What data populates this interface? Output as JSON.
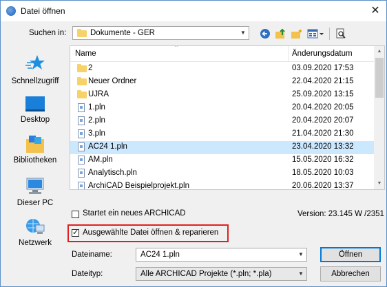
{
  "window": {
    "title": "Datei öffnen",
    "close_symbol": "✕"
  },
  "toolbar": {
    "look_in_label": "Suchen in:",
    "look_in_value": "Dokumente - GER"
  },
  "places": [
    {
      "label": "Schnellzugriff",
      "icon": "star-icon"
    },
    {
      "label": "Desktop",
      "icon": "desktop-icon"
    },
    {
      "label": "Bibliotheken",
      "icon": "libraries-icon"
    },
    {
      "label": "Dieser PC",
      "icon": "computer-icon"
    },
    {
      "label": "Netzwerk",
      "icon": "network-icon"
    }
  ],
  "filelist": {
    "col_name": "Name",
    "col_date": "Änderungsdatum",
    "rows": [
      {
        "name": "2",
        "date": "03.09.2020 17:53",
        "type": "folder"
      },
      {
        "name": "Neuer Ordner",
        "date": "22.04.2020 21:15",
        "type": "folder"
      },
      {
        "name": "UJRA",
        "date": "25.09.2020 13:15",
        "type": "folder"
      },
      {
        "name": "1.pln",
        "date": "20.04.2020 20:05",
        "type": "file"
      },
      {
        "name": "2.pln",
        "date": "20.04.2020 20:07",
        "type": "file"
      },
      {
        "name": "3.pln",
        "date": "21.04.2020 21:30",
        "type": "file"
      },
      {
        "name": "AC24 1.pln",
        "date": "23.04.2020 13:32",
        "type": "file",
        "selected": true
      },
      {
        "name": "AM.pln",
        "date": "15.05.2020 16:32",
        "type": "file"
      },
      {
        "name": "Analytisch.pln",
        "date": "18.05.2020 10:03",
        "type": "file"
      },
      {
        "name": "ArchiCAD Beispielprojekt.pln",
        "date": "20.06.2020 13:37",
        "type": "file"
      }
    ]
  },
  "options": {
    "new_archicad_label": "Startet ein neues ARCHICAD",
    "new_archicad_checked": false,
    "open_repair_label": "Ausgewählte Datei öffnen & reparieren",
    "open_repair_checked": true,
    "version_text": "Version: 23.145 W /2351"
  },
  "filename": {
    "label": "Dateiname:",
    "value": "AC24 1.pln"
  },
  "filetype": {
    "label": "Dateityp:",
    "value": "Alle ARCHICAD Projekte (*.pln; *.pla)"
  },
  "buttons": {
    "open": "Öffnen",
    "cancel": "Abbrechen"
  }
}
